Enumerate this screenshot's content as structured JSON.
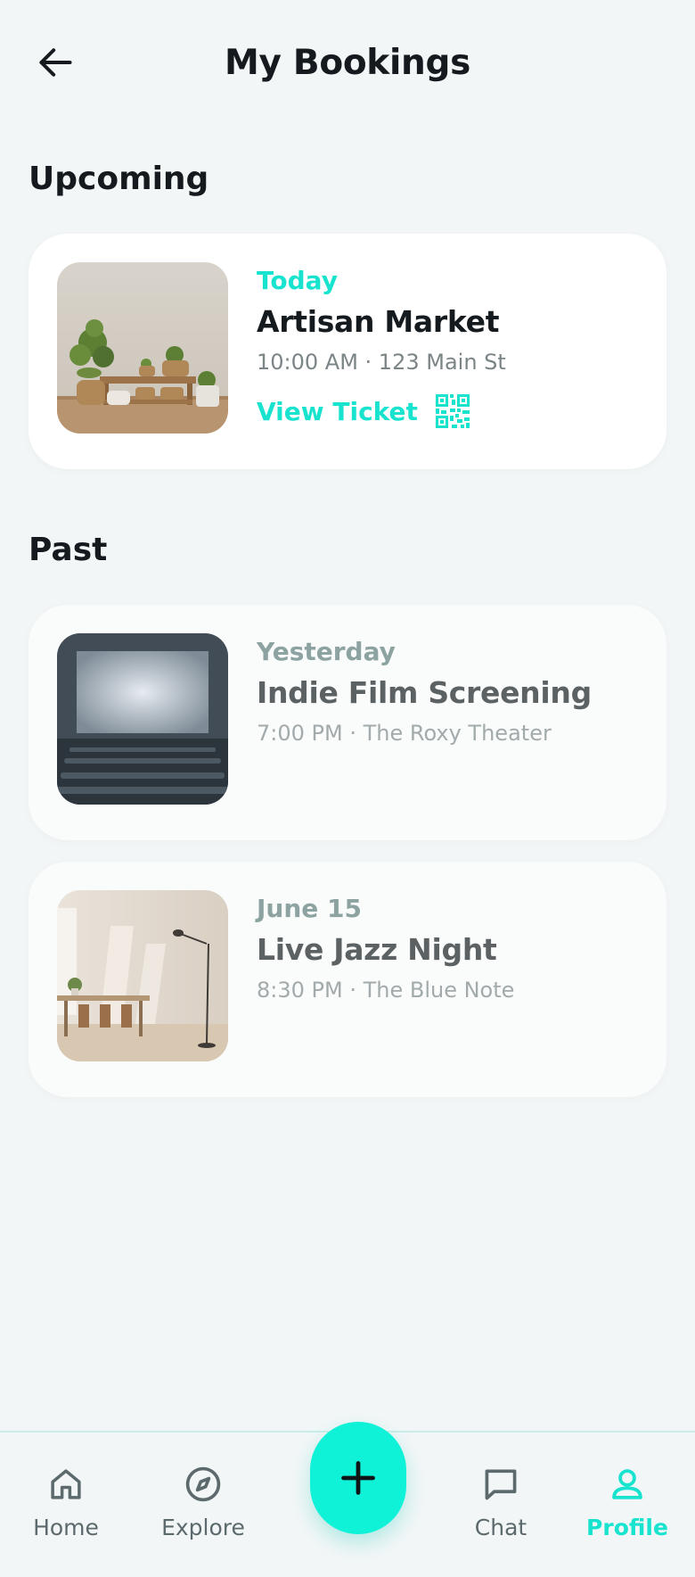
{
  "header": {
    "title": "My Bookings",
    "back_icon": "arrow-left-icon"
  },
  "sections": {
    "upcoming": "Upcoming",
    "past": "Past"
  },
  "upcoming": [
    {
      "when": "Today",
      "title": "Artisan Market",
      "meta": "10:00 AM · 123 Main St",
      "action": "View Ticket",
      "action_icon": "qr-code-icon"
    }
  ],
  "past": [
    {
      "when": "Yesterday",
      "title": "Indie Film Screening",
      "meta": "7:00 PM · The Roxy Theater"
    },
    {
      "when": "June 15",
      "title": "Live Jazz Night",
      "meta": "8:30 PM · The Blue Note"
    }
  ],
  "tabs": [
    {
      "label": "Home",
      "icon": "home-icon"
    },
    {
      "label": "Explore",
      "icon": "compass-icon"
    },
    {
      "label": "Chat",
      "icon": "chat-icon"
    },
    {
      "label": "Profile",
      "icon": "user-icon",
      "active": true
    }
  ],
  "fab": {
    "icon": "plus-icon"
  },
  "colors": {
    "accent": "#18e3cf",
    "fab": "#10f2d8",
    "background": "#f2f6f7",
    "muted": "#8ca3a1"
  }
}
